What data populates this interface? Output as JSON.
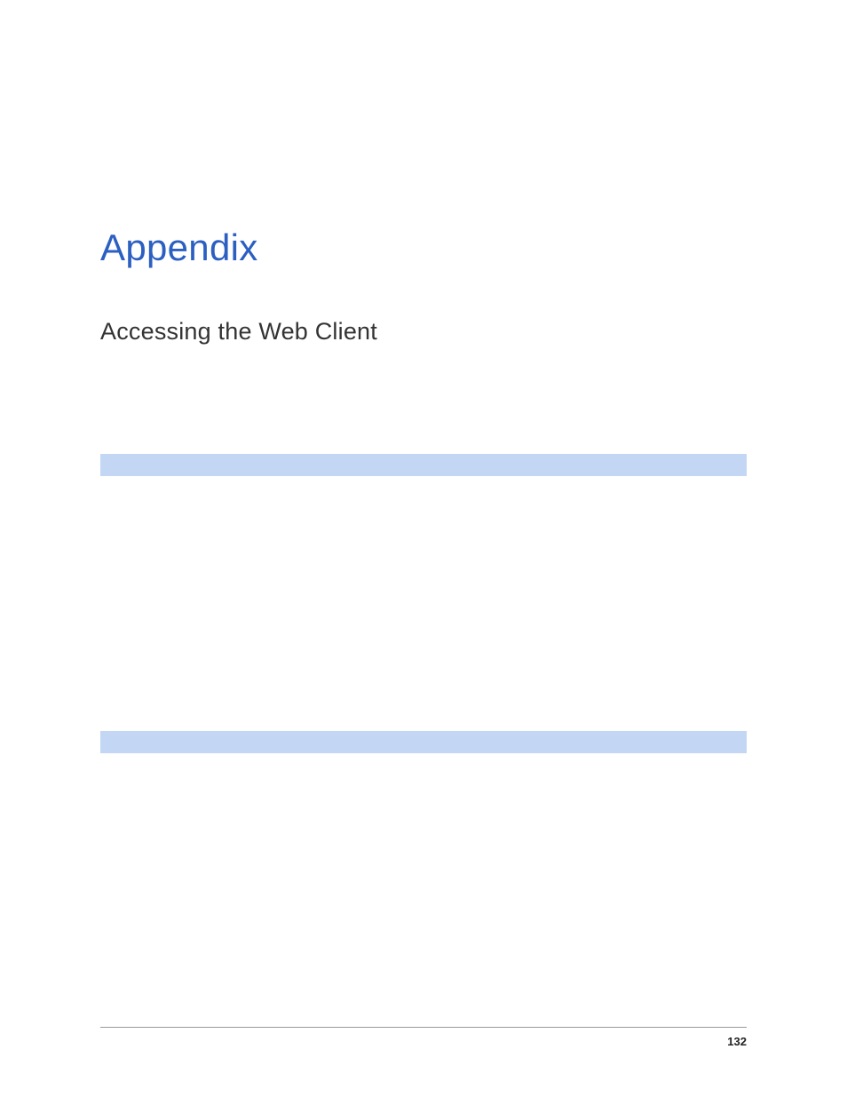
{
  "title": "Appendix",
  "subtitle": "Accessing the Web Client",
  "page_number": "132"
}
